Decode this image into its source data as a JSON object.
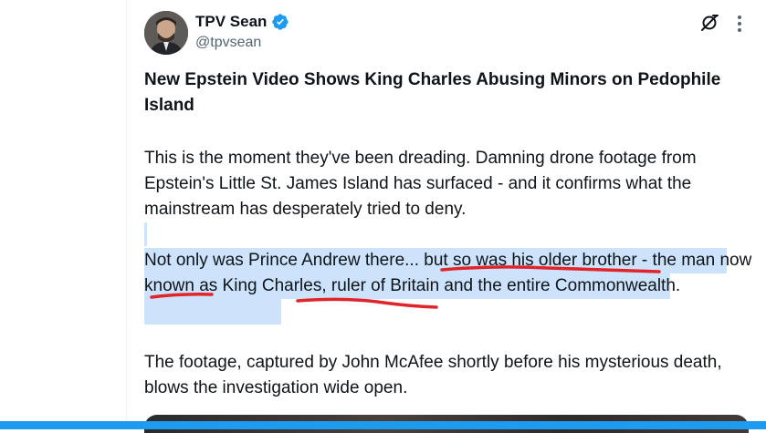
{
  "tweet": {
    "author_name": "TPV Sean",
    "author_handle": "@tpvsean",
    "title": "New Epstein Video Shows King Charles Abusing Minors on Pedophile Island",
    "paragraph1": "This is the moment they've been dreading. Damning drone footage from Epstein's Little St. James Island has surfaced - and it confirms what the mainstream has desperately tried to deny.",
    "paragraph2": "Not only was Prince Andrew there... but so was his older brother - the man now known as King Charles, ruler of Britain and the entire Commonwealth.",
    "paragraph3": "The footage, captured by John McAfee shortly before his mysterious death, blows the investigation wide open."
  },
  "icons": {
    "verified": "verified-badge-icon",
    "grok": "grok-icon",
    "more": "more-options-icon"
  },
  "colors": {
    "accent": "#1d9bf0",
    "selection": "#cde3fb",
    "underline": "#e0242a",
    "secondary_text": "#536471"
  }
}
